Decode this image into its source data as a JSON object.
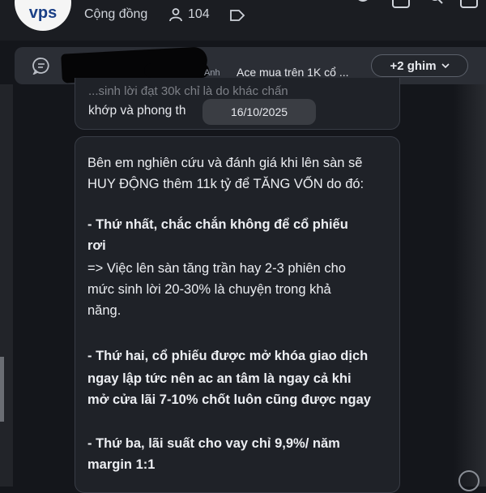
{
  "header": {
    "logo_text": "vps",
    "community_label": "Cộng đồng",
    "member_count": "104"
  },
  "pinned": {
    "author_suffix": "Anh",
    "title": "Ace mua trên 1K cổ ...",
    "pins_label": "+2 ghim"
  },
  "message1": {
    "partial_line": "...sinh lời đạt 30k chỉ là do khác chấn",
    "text": "khớp và phong th"
  },
  "date_pill": "16/10/2025",
  "message2": {
    "lines": [
      "Bên em nghiên cứu và đánh giá khi lên sàn sẽ",
      "HUY ĐỘNG thêm 11k tỷ để TĂNG VỐN do đó:",
      "",
      "- Thứ nhất, chắc chắn không để cổ phiếu",
      "rơi",
      "=> Việc lên sàn tăng trần hay 2-3 phiên cho",
      "mức sinh lời 20-30% là chuyện trong khả",
      "năng.",
      "",
      "- Thứ hai, cổ phiếu được mở khóa giao dịch",
      "ngay lập tức nên ac an tâm là ngay cả khi",
      "mở cửa lãi 7-10% chốt luôn cũng được ngay",
      "",
      "- Thứ ba, lãi suất cho vay chỉ 9,9%/ năm",
      "margin 1:1"
    ]
  },
  "colors": {
    "background": "#14161b",
    "bubble": "#1f2228",
    "pinbar": "#2b2e35",
    "text": "#e7e9ee"
  },
  "icons": [
    "people-icon",
    "tag-icon",
    "chat-bubble-icon",
    "chevron-down-icon",
    "people-group-icon",
    "video-icon",
    "search-icon",
    "window-icon"
  ]
}
